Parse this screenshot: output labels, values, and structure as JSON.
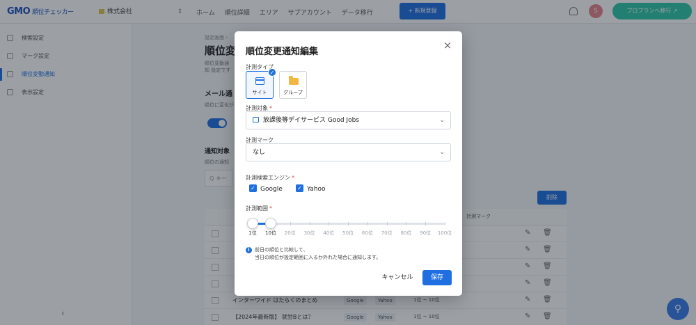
{
  "topbar": {
    "logo": "GMO",
    "logo_sub": "順位チェッカー",
    "project": "株式会社",
    "nav": [
      "ホーム",
      "順位詳細",
      "エリア",
      "サブアカウント",
      "データ移行"
    ],
    "add_project": "+ 新規登録",
    "avatar": "S",
    "upgrade": "プロプランへ移行 ↗"
  },
  "sidebar": {
    "items": [
      {
        "label": "検索設定"
      },
      {
        "label": "マーク設定"
      },
      {
        "label": "順位変動通知"
      },
      {
        "label": "表示設定"
      }
    ],
    "collapse": "‹"
  },
  "background": {
    "breadcrumb": "設定画面 ›",
    "title": "順位変",
    "desc": "順位変動通知 設定です",
    "email_heading": "メール通",
    "email_sub": "順位に変化があり",
    "targets_heading": "通知対象",
    "targets_sub": "順位の通知",
    "search_placeholder": "Q キー",
    "delete_button": "削除",
    "col_mark": "計測マーク",
    "rows": [
      {
        "keyword": "",
        "engine1": "",
        "engine2": "",
        "range": ""
      },
      {
        "keyword": "",
        "engine1": "",
        "engine2": "",
        "range": ""
      },
      {
        "keyword": "",
        "engine1": "",
        "engine2": "",
        "range": ""
      },
      {
        "keyword": "",
        "engine1": "",
        "engine2": "",
        "range": ""
      },
      {
        "keyword": "インターワイド はたらくのまとめ",
        "engine1": "Google",
        "engine2": "Yahoo",
        "range": "1位 ~ 10位"
      },
      {
        "keyword": "【2024年最新版】 就労Bとは？",
        "engine1": "Google",
        "engine2": "Yahoo",
        "range": "1位 ~ 10位"
      }
    ]
  },
  "modal": {
    "title": "順位変更通知編集",
    "close": "×",
    "type_label": "計測タイプ",
    "type_options": [
      {
        "label": "サイト",
        "selected": true,
        "icon": "site-icon"
      },
      {
        "label": "グループ",
        "selected": false,
        "icon": "folder-icon"
      }
    ],
    "check_mark": "✓",
    "target_label": "計測対象",
    "target_value": "放課後等デイサービス Good Jobs",
    "mark_label": "計測マーク",
    "mark_value": "なし",
    "engine_label": "計測検索エンジン",
    "engines": [
      {
        "label": "Google",
        "checked": true
      },
      {
        "label": "Yahoo",
        "checked": true
      }
    ],
    "range_label": "計測範囲",
    "required_mark": "*",
    "range": {
      "min": 1,
      "max": 10
    },
    "ticks": [
      "1位",
      "10位",
      "20位",
      "30位",
      "40位",
      "50位",
      "60位",
      "70位",
      "80位",
      "90位",
      "100位"
    ],
    "info_line1": "前日の順位と比較して、",
    "info_line2": "当日の順位が設定範囲に入るか外れた場合に通知します。",
    "info_icon": "i",
    "chevron": "⌄",
    "cancel": "キャンセル",
    "save": "保存"
  },
  "colors": {
    "primary": "#1f6fe0",
    "accent_green": "#2fc6a8",
    "required": "#e0484a"
  }
}
